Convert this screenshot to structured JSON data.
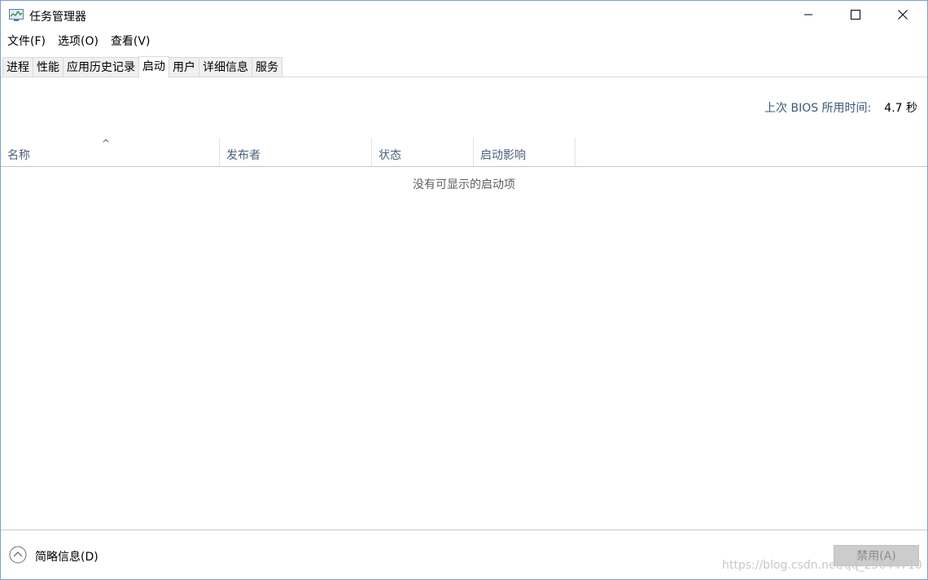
{
  "window": {
    "title": "任务管理器"
  },
  "menu": {
    "items": [
      {
        "label": "文件(F)"
      },
      {
        "label": "选项(O)"
      },
      {
        "label": "查看(V)"
      }
    ]
  },
  "tabs": [
    {
      "label": "进程",
      "active": false
    },
    {
      "label": "性能",
      "active": false
    },
    {
      "label": "应用历史记录",
      "active": false
    },
    {
      "label": "启动",
      "active": true
    },
    {
      "label": "用户",
      "active": false
    },
    {
      "label": "详细信息",
      "active": false
    },
    {
      "label": "服务",
      "active": false
    }
  ],
  "startup": {
    "bios_label": "上次 BIOS 所用时间:",
    "bios_value": "4.7 秒",
    "columns": [
      {
        "label": "名称"
      },
      {
        "label": "发布者"
      },
      {
        "label": "状态"
      },
      {
        "label": "启动影响"
      }
    ],
    "sort_indicator": "^",
    "empty_message": "没有可显示的启动项"
  },
  "footer": {
    "fewer_details_label": "简略信息(D)",
    "disable_label": "禁用(A)"
  },
  "watermark": "https://blog.csdn.net/qq_25644710",
  "icons": {
    "app": "task-manager-icon",
    "minimize": "minimize-icon",
    "maximize": "maximize-icon",
    "close": "close-icon",
    "collapse": "chevron-up-circle-icon",
    "sort": "sort-ascending-icon"
  }
}
